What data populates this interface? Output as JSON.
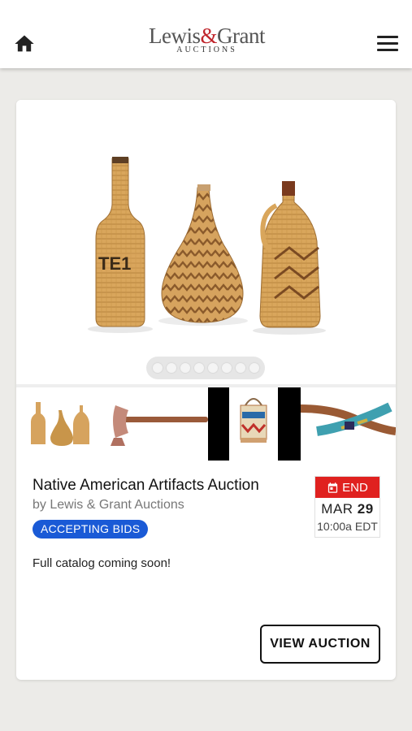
{
  "header": {
    "logo_main_a": "Lewis",
    "logo_amp": "&",
    "logo_main_b": "Grant",
    "logo_sub": "AUCTIONS",
    "home_icon": "home-icon",
    "menu_icon": "hamburger-menu-icon"
  },
  "carousel": {
    "slide_count": 8,
    "active_slide": 1
  },
  "auction": {
    "title": "Native American Artifacts Auction",
    "byline": "by Lewis & Grant Auctions",
    "status_badge": "ACCEPTING BIDS",
    "description": "Full catalog coming soon!",
    "view_button": "VIEW AUCTION"
  },
  "end_date": {
    "label": "END",
    "month": "MAR",
    "day": "29",
    "time": "10:00a EDT",
    "icon": "calendar-icon"
  },
  "colors": {
    "accent_blue": "#1a5ad6",
    "end_red": "#e0211f",
    "logo_red": "#c0262d"
  }
}
